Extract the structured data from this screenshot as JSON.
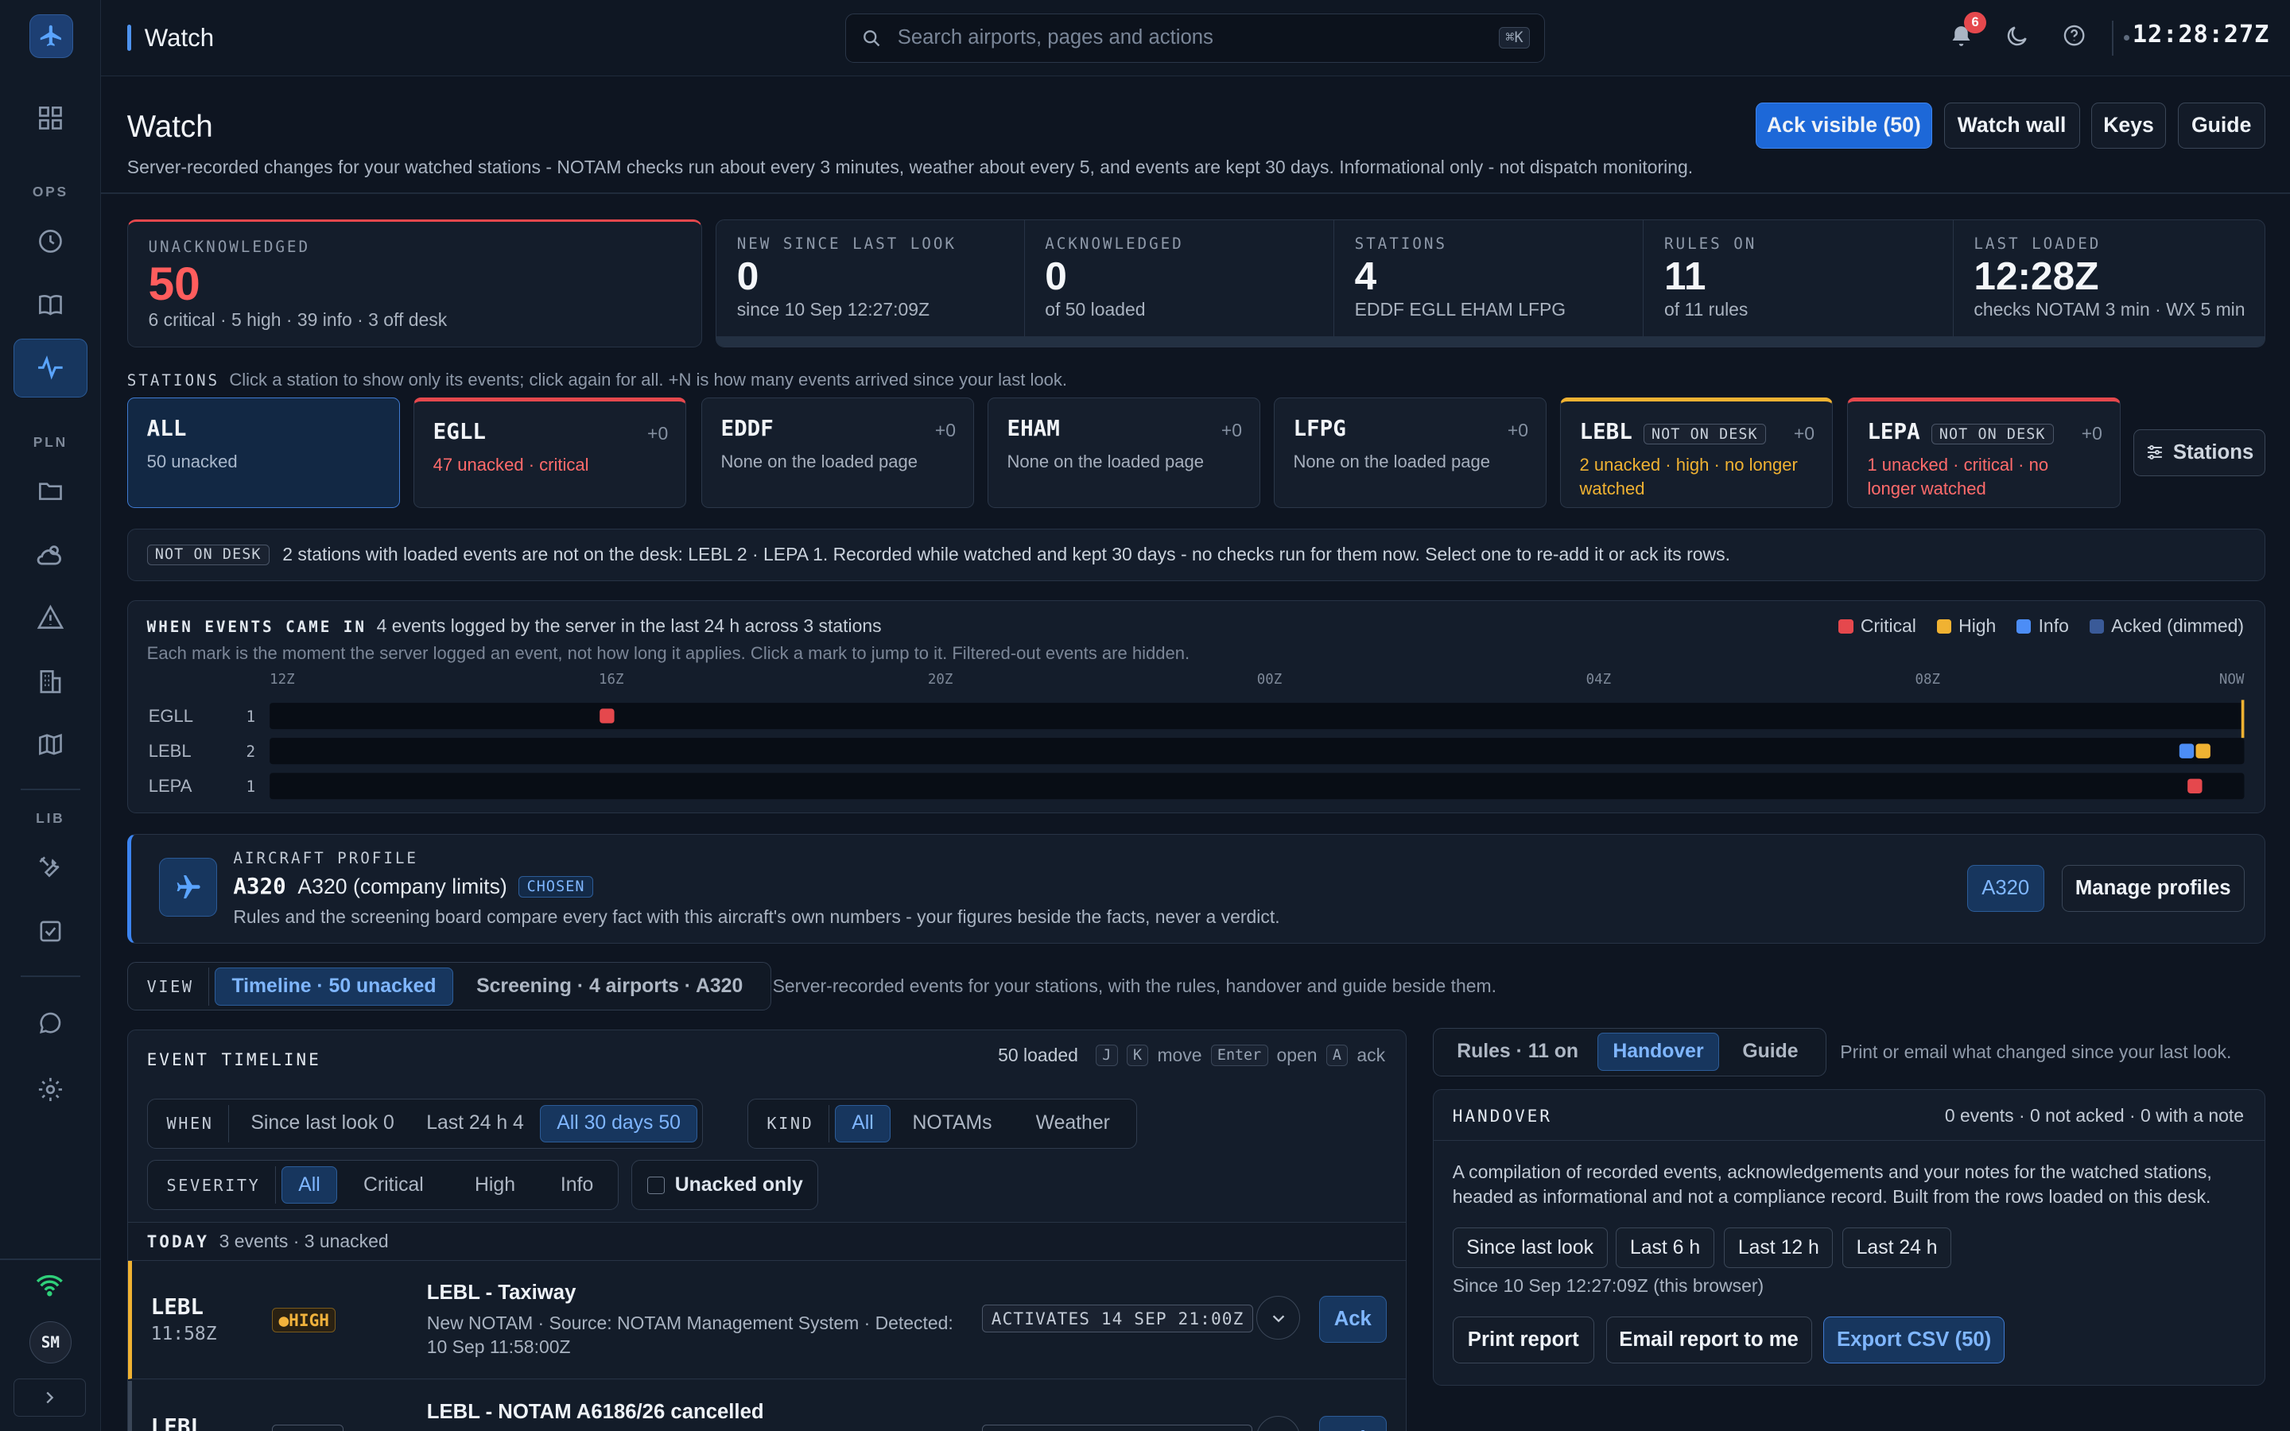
{
  "app": {
    "avatar": "SM",
    "clock": "12:28:27Z",
    "notifications": "6"
  },
  "rail": {
    "sections": [
      "OPS",
      "PLN",
      "LIB"
    ]
  },
  "topbar": {
    "title": "Watch",
    "search_placeholder": "Search airports, pages and actions",
    "search_kbd": "⌘K"
  },
  "page": {
    "title": "Watch",
    "subtitle": "Server-recorded changes for your watched stations - NOTAM checks run about every 3 minutes, weather about every 5, and events are kept 30 days. Informational only - not dispatch monitoring.",
    "actions": {
      "ack": "Ack visible (50)",
      "wall": "Watch wall",
      "keys": "Keys",
      "guide": "Guide"
    }
  },
  "stats": {
    "unack": {
      "label": "UNACKNOWLEDGED",
      "value": "50",
      "detail": "6 critical · 5 high · 39 info · 3 off desk"
    },
    "cells": [
      {
        "label": "NEW SINCE LAST LOOK",
        "value": "0",
        "detail": "since 10 Sep 12:27:09Z"
      },
      {
        "label": "ACKNOWLEDGED",
        "value": "0",
        "detail": "of 50 loaded"
      },
      {
        "label": "STATIONS",
        "value": "4",
        "detail": "EDDF EGLL EHAM LFPG"
      },
      {
        "label": "RULES ON",
        "value": "11",
        "detail": "of 11 rules"
      },
      {
        "label": "LAST LOADED",
        "value": "12:28Z",
        "detail": "checks NOTAM 3 min · WX 5 min"
      }
    ]
  },
  "stations": {
    "label": "STATIONS",
    "hint": "Click a station to show only its events; click again for all. +N is how many events arrived since your last look.",
    "off_desk_tag": "NOT ON DESK",
    "manage": "Stations",
    "items": [
      {
        "name": "ALL",
        "delta": "",
        "detail": "50 unacked"
      },
      {
        "name": "EGLL",
        "delta": "+0",
        "detail": "47 unacked · critical"
      },
      {
        "name": "EDDF",
        "delta": "+0",
        "detail": "None on the loaded page"
      },
      {
        "name": "EHAM",
        "delta": "+0",
        "detail": "None on the loaded page"
      },
      {
        "name": "LFPG",
        "delta": "+0",
        "detail": "None on the loaded page"
      },
      {
        "name": "LEBL",
        "delta": "+0",
        "detail": "2 unacked · high · no longer watched"
      },
      {
        "name": "LEPA",
        "delta": "+0",
        "detail": "1 unacked · critical · no longer watched"
      }
    ]
  },
  "notice": {
    "tag": "NOT ON DESK",
    "text": "2 stations with loaded events are not on the desk: LEBL 2 · LEPA 1. Recorded while watched and kept 30 days - no checks run for them now. Select one to re-add it or ack its rows."
  },
  "timeline_chart": {
    "title": "WHEN EVENTS CAME IN",
    "summary": "4 events logged by the server in the last 24 h across 3 stations",
    "hint": "Each mark is the moment the server logged an event, not how long it applies. Click a mark to jump to it. Filtered-out events are hidden.",
    "legend": [
      {
        "label": "Critical",
        "color": "#e5484d"
      },
      {
        "label": "High",
        "color": "#f0b232"
      },
      {
        "label": "Info",
        "color": "#4c8df6"
      },
      {
        "label": "Acked (dimmed)",
        "color": "#3a5a98"
      }
    ],
    "ticks": [
      "12Z",
      "16Z",
      "20Z",
      "00Z",
      "04Z",
      "08Z",
      "NOW"
    ],
    "rows": [
      {
        "station": "EGLL",
        "count": "1"
      },
      {
        "station": "LEBL",
        "count": "2"
      },
      {
        "station": "LEPA",
        "count": "1"
      }
    ]
  },
  "chart_data": {
    "type": "scatter",
    "x_axis": [
      "12Z",
      "16Z",
      "20Z",
      "00Z",
      "04Z",
      "08Z",
      "NOW"
    ],
    "window_hours": 24,
    "rows": [
      "EGLL",
      "LEBL",
      "LEPA"
    ],
    "events": [
      {
        "station": "EGLL",
        "hours_ago": 19.9,
        "severity": "critical"
      },
      {
        "station": "LEBL",
        "hours_ago": 0.7,
        "severity": "info"
      },
      {
        "station": "LEBL",
        "hours_ago": 0.5,
        "severity": "high"
      },
      {
        "station": "LEPA",
        "hours_ago": 0.6,
        "severity": "critical"
      }
    ]
  },
  "profile": {
    "label": "AIRCRAFT PROFILE",
    "code": "A320",
    "name": "A320 (company limits)",
    "badge": "CHOSEN",
    "desc": "Rules and the screening board compare every fact with this aircraft's own numbers - your figures beside the facts, never a verdict.",
    "selected": "A320",
    "manage": "Manage profiles"
  },
  "view": {
    "label": "VIEW",
    "tabs": [
      "Timeline · 50 unacked",
      "Screening · 4 airports · A320"
    ],
    "desc": "Server-recorded events for your stations, with the rules, handover and guide beside them."
  },
  "events": {
    "title": "EVENT TIMELINE",
    "loaded": "50 loaded",
    "keys": [
      {
        "k": "J"
      },
      {
        "k": "K"
      },
      {
        "t": "move"
      },
      {
        "k": "Enter"
      },
      {
        "t": "open"
      },
      {
        "k": "A"
      },
      {
        "t": "ack"
      }
    ],
    "when": {
      "label": "WHEN",
      "options": [
        "Since last look 0",
        "Last 24 h 4",
        "All 30 days 50"
      ]
    },
    "kind": {
      "label": "KIND",
      "options": [
        "All",
        "NOTAMs",
        "Weather"
      ]
    },
    "severity": {
      "label": "SEVERITY",
      "options": [
        "All",
        "Critical",
        "High",
        "Info"
      ]
    },
    "unacked_only": "Unacked only",
    "group": {
      "label": "TODAY",
      "meta": "3 events · 3 unacked"
    },
    "rows": [
      {
        "station": "LEBL",
        "time": "11:58Z",
        "severity": "●HIGH",
        "title": "LEBL - Taxiway",
        "meta": "New NOTAM · Source: NOTAM Management System · Detected: 10 Sep 11:58:00Z",
        "activates": "ACTIVATES 14 SEP 21:00Z",
        "ack": "Ack"
      },
      {
        "station": "LEBL",
        "time": "",
        "severity": "",
        "title": "LEBL - NOTAM A6186/26 cancelled",
        "meta": "",
        "activates": "",
        "ack": "Ack"
      }
    ]
  },
  "sidepanel": {
    "tabs": [
      "Rules · 11 on",
      "Handover",
      "Guide"
    ],
    "hint": "Print or email what changed since your last look.",
    "handover": {
      "title": "HANDOVER",
      "stats": "0 events · 0 not acked · 0 with a note",
      "desc": "A compilation of recorded events, acknowledgements and your notes for the watched stations, headed as informational and not a compliance record. Built from the rows loaded on this desk.",
      "ranges": [
        "Since last look",
        "Last 6 h",
        "Last 12 h",
        "Last 24 h"
      ],
      "since": "Since 10 Sep 12:27:09Z (this browser)",
      "print": "Print report",
      "email": "Email report to me",
      "export": "Export CSV (50)"
    }
  }
}
